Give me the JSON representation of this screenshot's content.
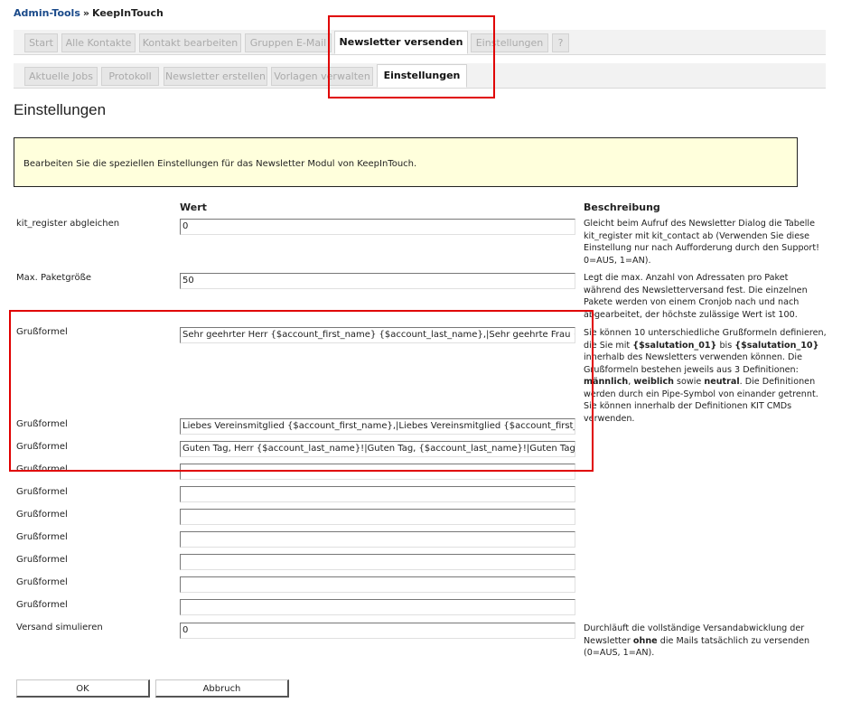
{
  "breadcrumb": {
    "root": "Admin-Tools",
    "separator": "»",
    "current": "KeepInTouch"
  },
  "main_tabs": [
    {
      "label": "Start"
    },
    {
      "label": "Alle Kontakte"
    },
    {
      "label": "Kontakt bearbeiten"
    },
    {
      "label": "Gruppen E-Mail"
    },
    {
      "label": "Newsletter versenden"
    },
    {
      "label": "Einstellungen"
    },
    {
      "label": "?"
    }
  ],
  "sub_tabs": [
    {
      "label": "Aktuelle Jobs"
    },
    {
      "label": "Protokoll"
    },
    {
      "label": "Newsletter erstellen"
    },
    {
      "label": "Vorlagen verwalten"
    },
    {
      "label": "Einstellungen"
    }
  ],
  "page_title": "Einstellungen",
  "info_text": "Bearbeiten Sie die speziellen Einstellungen für das Newsletter Modul von KeepInTouch.",
  "columns": {
    "value": "Wert",
    "description": "Beschreibung"
  },
  "rows": {
    "kit_register": {
      "label": "kit_register abgleichen",
      "value": "0",
      "description": "Gleicht beim Aufruf des Newsletter Dialog die Tabelle kit_register mit kit_contact ab (Verwenden Sie diese Einstellung nur nach Aufforderung durch den Support! 0=AUS, 1=AN)."
    },
    "packet_size": {
      "label": "Max. Paketgröße",
      "value": "50",
      "description": "Legt die max. Anzahl von Adressaten pro Paket während des Newsletterversand fest. Die einzelnen Pakete werden von einem Cronjob nach und nach abgearbeitet, der höchste zulässige Wert ist 100."
    },
    "salutation_label": "Grußformel",
    "salutations": [
      "Sehr geehrter Herr {$account_first_name} {$account_last_name},|Sehr geehrte Frau {$account_first_name} {$account_last_name},|Sehr geehrte Damen und Herren,",
      "Liebes Vereinsmitglied {$account_first_name},|Liebes Vereinsmitglied {$account_first_name},|Liebe Vereinsmitglieder,",
      "Guten Tag, Herr {$account_last_name}!|Guten Tag, {$account_last_name}!|Guten Tag!",
      "",
      "",
      "",
      "",
      "",
      "",
      ""
    ],
    "salutation_description": {
      "p1": "Sie können 10 unterschiedliche Grußformeln definieren, die Sie mit ",
      "code1": "{$salutation_01}",
      "p2": " bis ",
      "code2": "{$salutation_10}",
      "p3": " innerhalb des Newsletters verwenden können. Die Grußformeln bestehen jeweils aus 3 Definitionen: ",
      "b1": "männlich",
      "p4": ", ",
      "b2": "weiblich",
      "p5": " sowie ",
      "b3": "neutral",
      "p6": ". Die Definitionen werden durch ein Pipe-Symbol von einander getrennt. Sie können innerhalb der Definitionen KIT CMDs verwenden."
    },
    "simulate": {
      "label": "Versand simulieren",
      "value": "0",
      "description_p1": "Durchläuft die vollständige Versandabwicklung der Newsletter ",
      "description_bold": "ohne",
      "description_p2": " die Mails tatsächlich zu versenden (0=AUS, 1=AN)."
    }
  },
  "buttons": {
    "ok": "OK",
    "cancel": "Abbruch"
  },
  "colors": {
    "highlight": "#e00000",
    "info_bg": "#ffffdc",
    "link": "#1a4a8a"
  }
}
